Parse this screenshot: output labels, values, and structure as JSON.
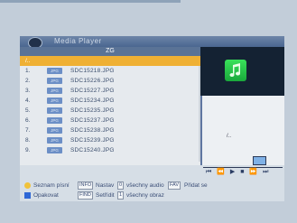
{
  "window": {
    "title": "Media Player",
    "folder": "ZG"
  },
  "files": [
    {
      "num": "/..",
      "badge": "",
      "name": ""
    },
    {
      "num": "1.",
      "badge": "JPG",
      "name": "SDC15218.JPG"
    },
    {
      "num": "2.",
      "badge": "JPG",
      "name": "SDC15226.JPG"
    },
    {
      "num": "3.",
      "badge": "JPG",
      "name": "SDC15227.JPG"
    },
    {
      "num": "4.",
      "badge": "JPG",
      "name": "SDC15234.JPG"
    },
    {
      "num": "5.",
      "badge": "JPG",
      "name": "SDC15235.JPG"
    },
    {
      "num": "6.",
      "badge": "JPG",
      "name": "SDC15237.JPG"
    },
    {
      "num": "7.",
      "badge": "JPG",
      "name": "SDC15238.JPG"
    },
    {
      "num": "8.",
      "badge": "JPG",
      "name": "SDC15239.JPG"
    },
    {
      "num": "9.",
      "badge": "JPG",
      "name": "SDC15240.JPG"
    }
  ],
  "preview": {
    "info": "/..",
    "icon": "music-note-icon"
  },
  "controls": {
    "symbols": "⏮ ⏪ ▶ ■ ⏩ ⏭"
  },
  "legend": {
    "row1": {
      "label": "Seznam písní",
      "k1": "INFO",
      "t1": "Nastav",
      "k2": "0",
      "t2": "všechny audio",
      "k3": "FAV",
      "t3": "Přidat se"
    },
    "row2": {
      "label": "Opakovat",
      "k1": "FIND",
      "t1": "Setřídit",
      "k2": "1",
      "t2": "všechny obraz"
    }
  },
  "colors": {
    "selected": "#efb034",
    "legend_yellow": "#f0c23a",
    "legend_blue": "#2e67d6"
  }
}
